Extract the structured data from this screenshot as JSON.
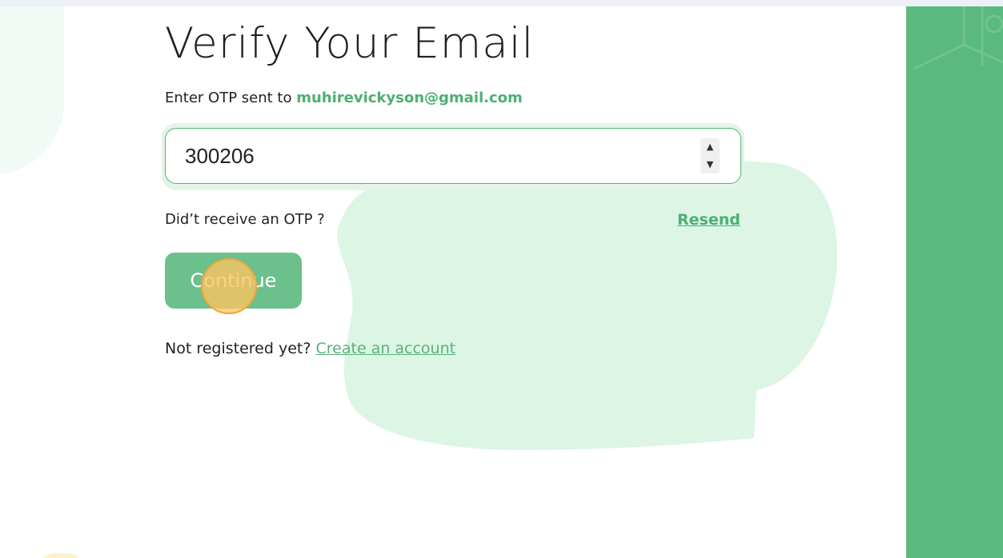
{
  "page": {
    "title": "Verify Your Email",
    "subtitle_prefix": "Enter OTP sent to",
    "email": "muhirevickyson@gmail.com"
  },
  "otp": {
    "value": "300206",
    "spinner_up": "▲",
    "spinner_down": "▼"
  },
  "resend": {
    "prompt": "Did’t receive an OTP ?",
    "link": "Resend"
  },
  "continue": {
    "label": "Continue"
  },
  "register": {
    "prompt": "Not registered yet?",
    "link": "Create an account"
  },
  "colors": {
    "accent": "#5aba7d",
    "button": "#6cc08b",
    "link": "#4cb072",
    "click_marker": "#fcc462"
  }
}
